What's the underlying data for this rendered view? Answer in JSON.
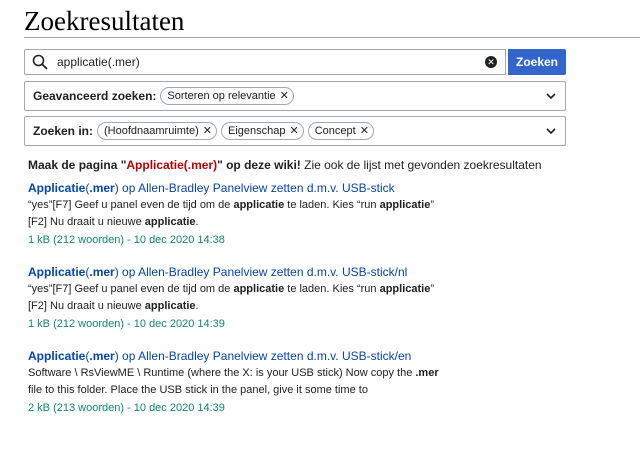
{
  "page": {
    "title": "Zoekresultaten"
  },
  "search": {
    "value": "applicatie(.mer)",
    "button_label": "Zoeken"
  },
  "advanced": {
    "label": "Geavanceerd zoeken:",
    "chips": [
      {
        "label": "Sorteren op relevantie"
      }
    ]
  },
  "namespaces": {
    "label": "Zoeken in:",
    "chips": [
      {
        "label": "(Hoofdnaamruimte)"
      },
      {
        "label": "Eigenschap"
      },
      {
        "label": "Concept"
      }
    ]
  },
  "did_you_mean": {
    "prefix": "Maak de pagina \"",
    "link": "Applicatie(.mer)",
    "suffix": "\" op deze wiki!",
    "rest": " Zie ook de lijst met gevonden zoekresultaten"
  },
  "results": [
    {
      "title_hl": "Applicatie",
      "title_mid": "(",
      "title_hl2": ".mer",
      "title_rest": ") op Allen-Bradley Panelview zetten d.m.v. USB-stick",
      "line1": [
        {
          "t": "“yes”[F7] Geef u panel even de tijd om de ",
          "b": false
        },
        {
          "t": "applicatie",
          "b": true
        },
        {
          "t": " te laden. Kies “run ",
          "b": false
        },
        {
          "t": "applicatie",
          "b": true
        },
        {
          "t": "”",
          "b": false
        }
      ],
      "line2": [
        {
          "t": "[F2] Nu draait u nieuwe ",
          "b": false
        },
        {
          "t": "applicatie",
          "b": true
        },
        {
          "t": ".",
          "b": false
        }
      ],
      "meta": "1 kB (212 woorden) - 10 dec 2020 14:38"
    },
    {
      "title_hl": "Applicatie",
      "title_mid": "(",
      "title_hl2": ".mer",
      "title_rest": ") op Allen-Bradley Panelview zetten d.m.v. USB-stick/nl",
      "line1": [
        {
          "t": "“yes”[F7] Geef u panel even de tijd om de ",
          "b": false
        },
        {
          "t": "applicatie",
          "b": true
        },
        {
          "t": " te laden. Kies “run ",
          "b": false
        },
        {
          "t": "applicatie",
          "b": true
        },
        {
          "t": "”",
          "b": false
        }
      ],
      "line2": [
        {
          "t": "[F2] Nu draait u nieuwe ",
          "b": false
        },
        {
          "t": "applicatie",
          "b": true
        },
        {
          "t": ".",
          "b": false
        }
      ],
      "meta": "1 kB (212 woorden) - 10 dec 2020 14:39"
    },
    {
      "title_hl": "Applicatie",
      "title_mid": "(",
      "title_hl2": ".mer",
      "title_rest": ") op Allen-Bradley Panelview zetten d.m.v. USB-stick/en",
      "line1": [
        {
          "t": "Software \\ RsViewME \\ Runtime (where the X: is your USB stick) Now copy the ",
          "b": false
        },
        {
          "t": ".mer",
          "b": true
        }
      ],
      "line2": [
        {
          "t": "file to this folder. Place the USB stick in the panel, give it some time to",
          "b": false
        }
      ],
      "meta": "2 kB (213 woorden) - 10 dec 2020 14:39"
    }
  ]
}
